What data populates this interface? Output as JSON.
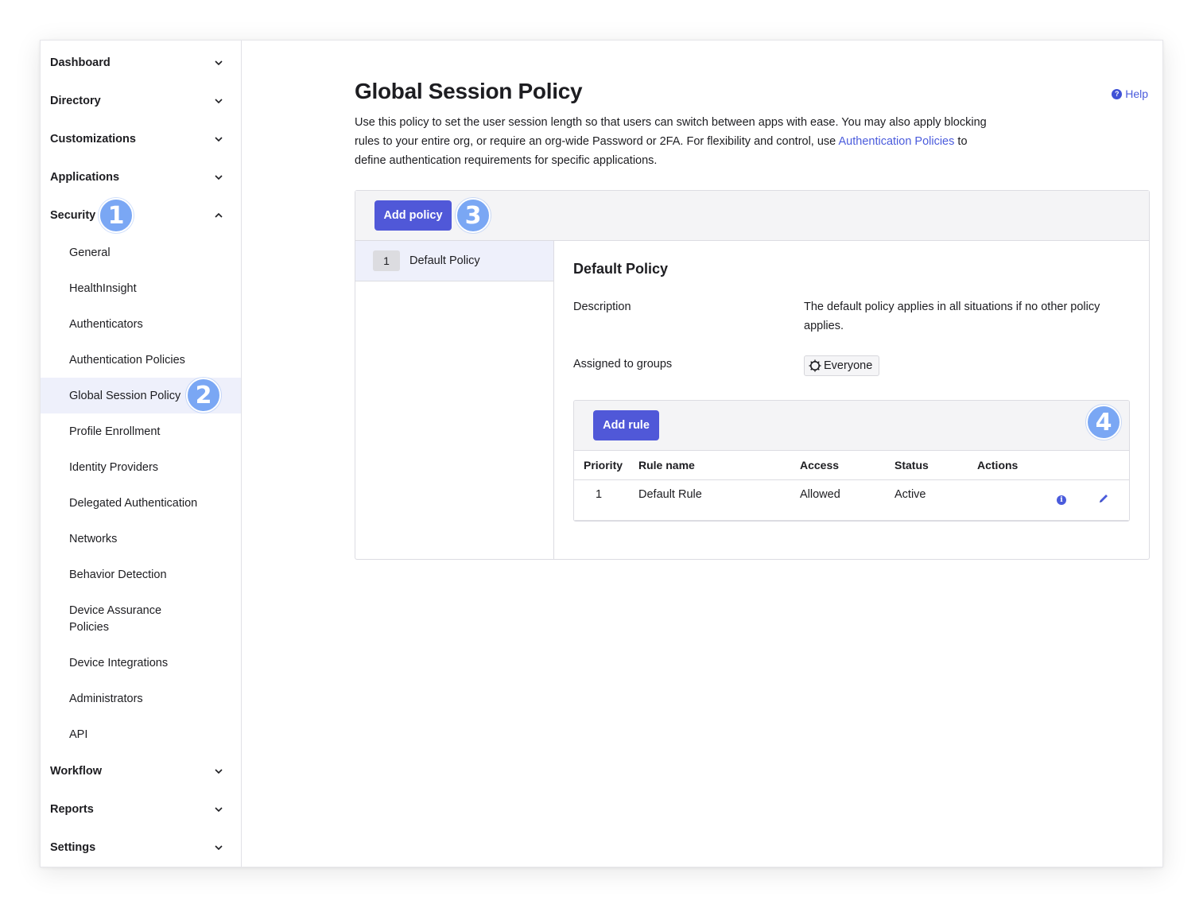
{
  "sidebar": {
    "top_items": {
      "dashboard": "Dashboard",
      "directory": "Directory",
      "customizations": "Customizations",
      "applications": "Applications",
      "security": "Security",
      "workflow": "Workflow",
      "reports": "Reports",
      "settings": "Settings"
    },
    "security_items": [
      "General",
      "HealthInsight",
      "Authenticators",
      "Authentication Policies",
      "Global Session Policy",
      "Profile Enrollment",
      "Identity Providers",
      "Delegated Authentication",
      "Networks",
      "Behavior Detection",
      "Device Assurance Policies",
      "Device Integrations",
      "Administrators",
      "API"
    ],
    "active_item": "Global Session Policy"
  },
  "callouts": [
    "1",
    "2",
    "3",
    "4"
  ],
  "main": {
    "title": "Global Session Policy",
    "help_label": "Help",
    "intro_text_1": "Use this policy to set the user session length so that users can switch between apps with ease. You may also apply blocking rules to your entire org, or require an org-wide Password or 2FA. For flexibility and control, use ",
    "intro_link": "Authentication Policies",
    "intro_text_2": " to define authentication requirements for specific applications.",
    "add_policy_label": "Add policy",
    "policies": [
      {
        "priority": "1",
        "name": "Default Policy"
      }
    ],
    "detail": {
      "title": "Default Policy",
      "description_label": "Description",
      "description_value": "The default policy applies in all situations if no other policy applies.",
      "groups_label": "Assigned to groups",
      "group_value": "Everyone",
      "add_rule_label": "Add rule",
      "rules_columns": [
        "Priority",
        "Rule name",
        "Access",
        "Status",
        "Actions"
      ],
      "rules": [
        {
          "priority": "1",
          "name": "Default Rule",
          "access": "Allowed",
          "status": "Active"
        }
      ]
    }
  },
  "colors": {
    "accent": "#5058d8",
    "link": "#4a5bdc",
    "callout": "#7aa7f4",
    "active_bg": "#eef0fb"
  },
  "icons": [
    "chevron-down-icon",
    "chevron-up-icon",
    "help-icon",
    "everyone-group-icon",
    "info-icon",
    "edit-pencil-icon"
  ]
}
